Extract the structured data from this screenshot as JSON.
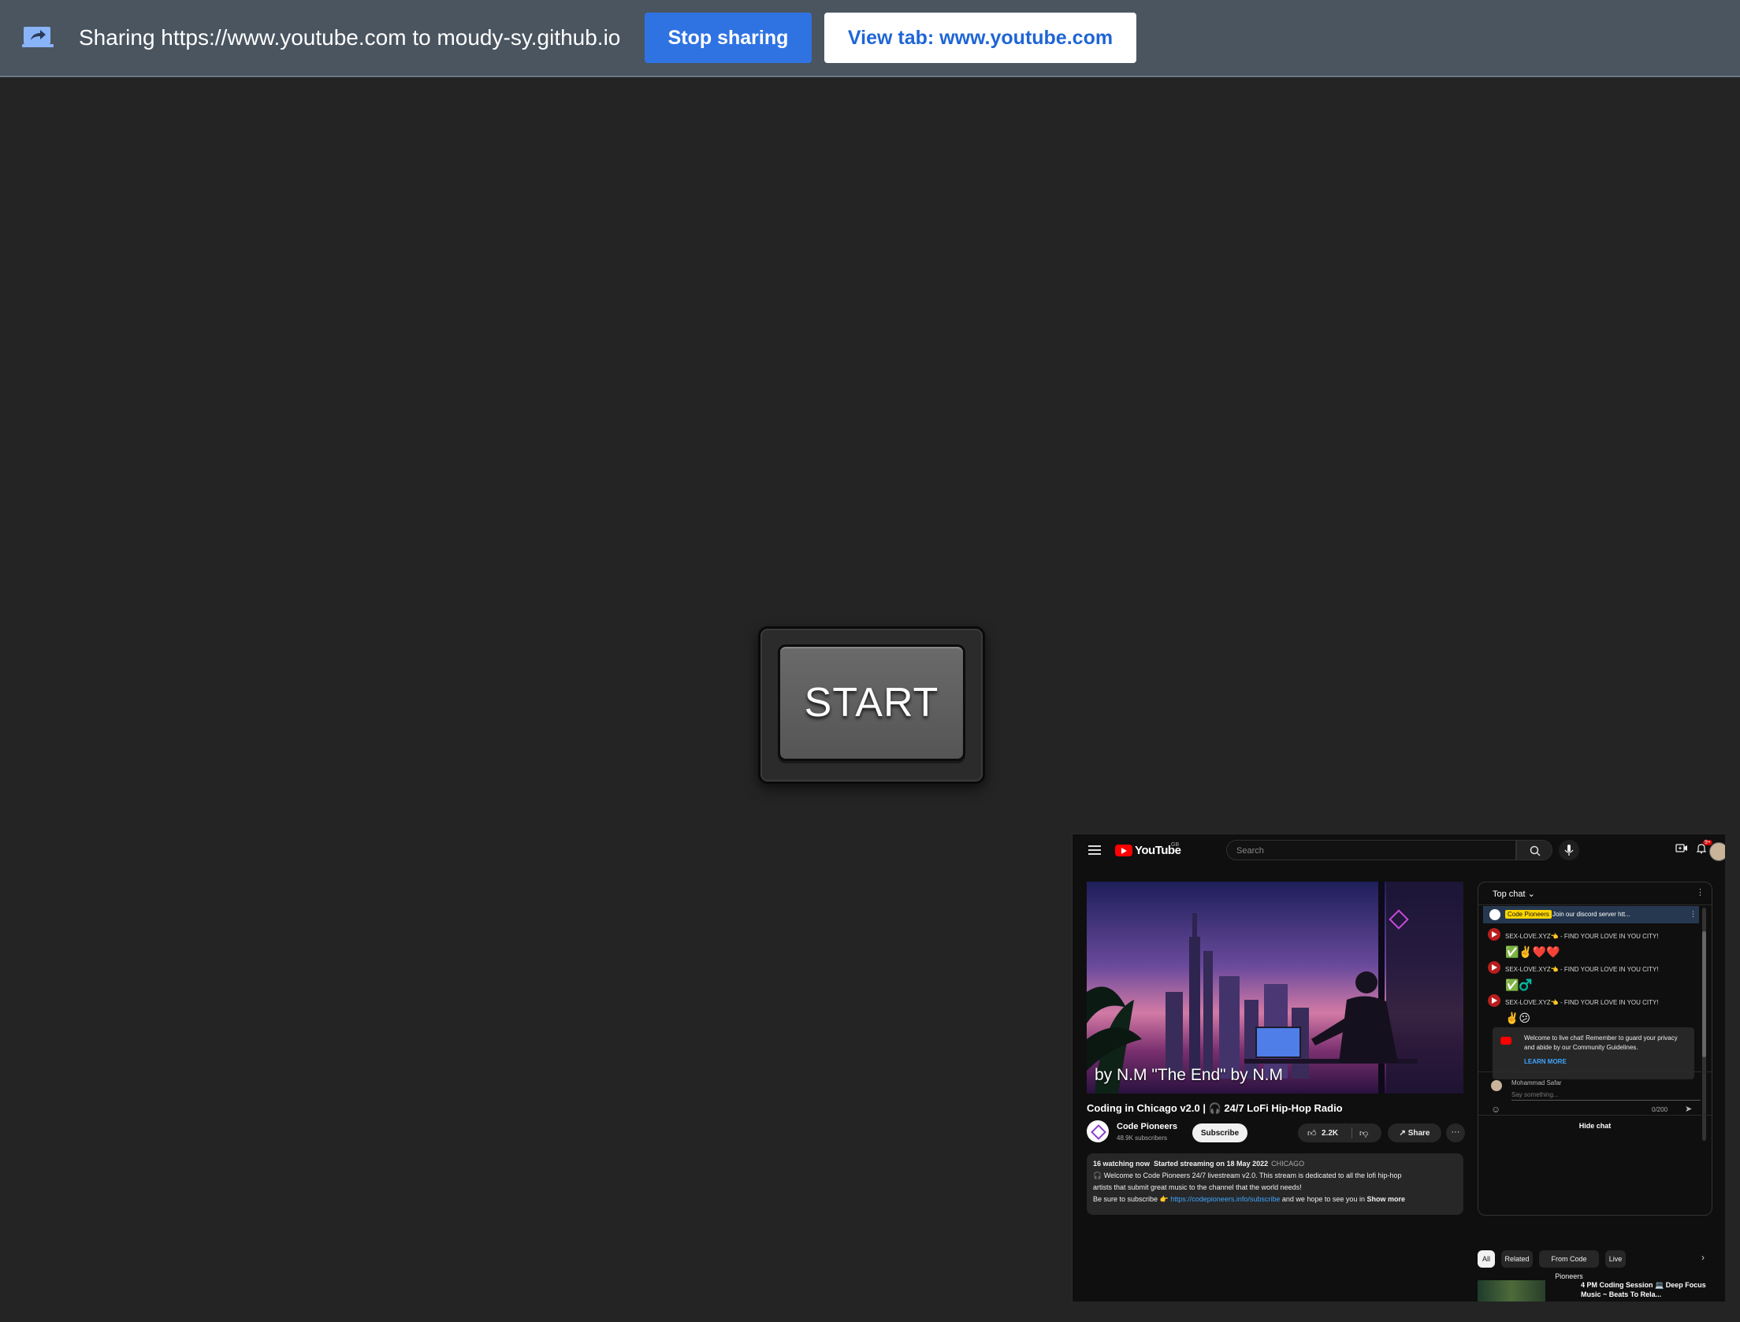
{
  "share_bar": {
    "icon": "screen-share-icon",
    "text": "Sharing https://www.youtube.com to moudy-sy.github.io",
    "stop_label": "Stop sharing",
    "view_label": "View tab: www.youtube.com"
  },
  "main": {
    "start_label": "START"
  },
  "youtube": {
    "logo_text": "YouTube",
    "region": "GB",
    "search_placeholder": "Search",
    "notification_count": "9+",
    "video": {
      "caption": "by N.M \"The End\" by N.M",
      "title": "Coding in Chicago v2.0 | 🎧 24/7 LoFi Hip-Hop Radio"
    },
    "channel": {
      "name": "Code Pioneers",
      "subscribers": "48.9K subscribers",
      "subscribe_label": "Subscribe",
      "likes": "2.2K",
      "share_label": "Share"
    },
    "description": {
      "watching": "16 watching now",
      "started": "Started streaming on 18 May 2022",
      "tag": "CHICAGO",
      "line1": "🎧 Welcome to Code Pioneers 24/7 livestream v2.0. This stream is dedicated to all the lofi hip-hop",
      "line2": "artists that submit great music to the channel that the world needs!",
      "line3_prefix": "Be sure to subscribe 👉",
      "line3_link": "https://codepioneers.info/subscribe",
      "line3_suffix": "and we hope to see you in",
      "show_more": "Show more"
    },
    "chat": {
      "header": "Top chat",
      "pinned_author": "Code Pioneers",
      "pinned_text": "Join our discord server htt...",
      "messages": [
        {
          "text": "SEX-LOVE.XYZ👈 - FIND YOUR LOVE IN YOU CITY!",
          "emoji": "✅✌️❤️❤️"
        },
        {
          "text": "SEX-LOVE.XYZ👈 - FIND YOUR LOVE IN YOU CITY!",
          "emoji": "✅♂️"
        },
        {
          "text": "SEX-LOVE.XYZ👈 - FIND YOUR LOVE IN YOU CITY!",
          "emoji": "✌️😕"
        }
      ],
      "welcome_text": "Welcome to live chat! Remember to guard your privacy and abide by our Community Guidelines.",
      "learn_more": "LEARN MORE",
      "user_name": "Mohammad Safar",
      "input_placeholder": "Say something...",
      "char_count": "0/200",
      "hide_chat": "Hide chat"
    },
    "chips": [
      "All",
      "Related",
      "From Code Pioneers",
      "Live"
    ],
    "recommended_title": "4 PM Coding Session 💻 Deep Focus Music ~ Beats To Rela..."
  }
}
